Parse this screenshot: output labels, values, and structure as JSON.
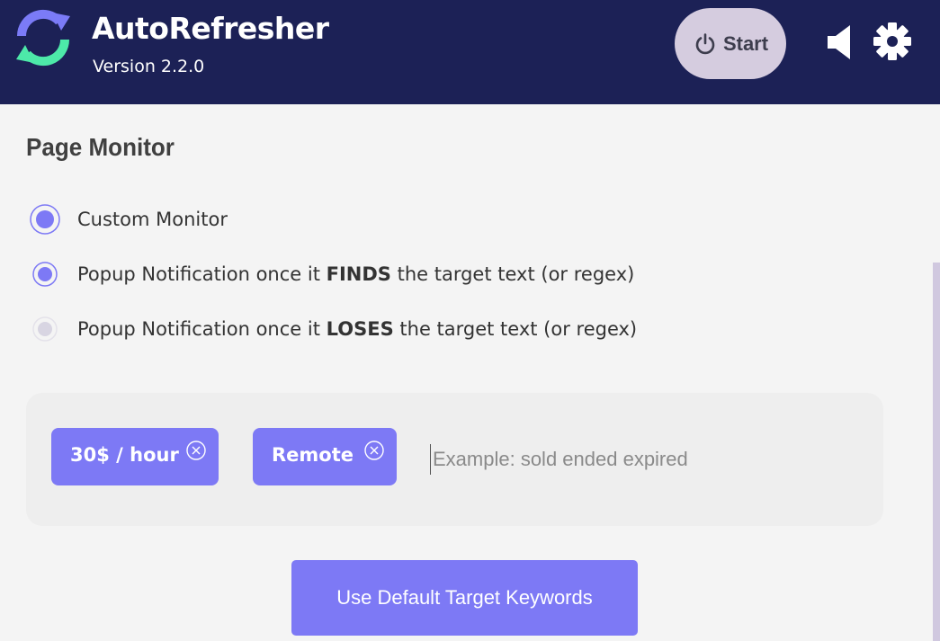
{
  "app": {
    "title": "AutoRefresher",
    "version": "Version 2.2.0"
  },
  "header": {
    "start_label": "Start",
    "icons": [
      "refresh-logo-icon",
      "power-icon",
      "speaker-icon",
      "gear-icon"
    ]
  },
  "page_monitor": {
    "title": "Page Monitor",
    "options": [
      {
        "text": "Custom Monitor",
        "bold": "",
        "suffix": "",
        "state": "selected"
      },
      {
        "text": "Popup Notification once it ",
        "bold": "FINDS",
        "suffix": " the target text (or regex)",
        "state": "selected"
      },
      {
        "text": "Popup Notification once it ",
        "bold": "LOSES",
        "suffix": " the target text (or regex)",
        "state": "disabled"
      }
    ]
  },
  "keywords": {
    "tags": [
      "30$ / hour",
      "Remote"
    ],
    "input_placeholder": "Example: sold ended expired",
    "input_value": ""
  },
  "default_button_label": "Use Default Target Keywords",
  "colors": {
    "header_bg": "#1c2156",
    "accent": "#7d79f5",
    "start_bg": "#d5ccdf",
    "logo_blue": "#7b7bf7",
    "logo_green": "#4de9a9",
    "panel_bg": "#eeeeee",
    "page_bg": "#f4f4f4"
  }
}
